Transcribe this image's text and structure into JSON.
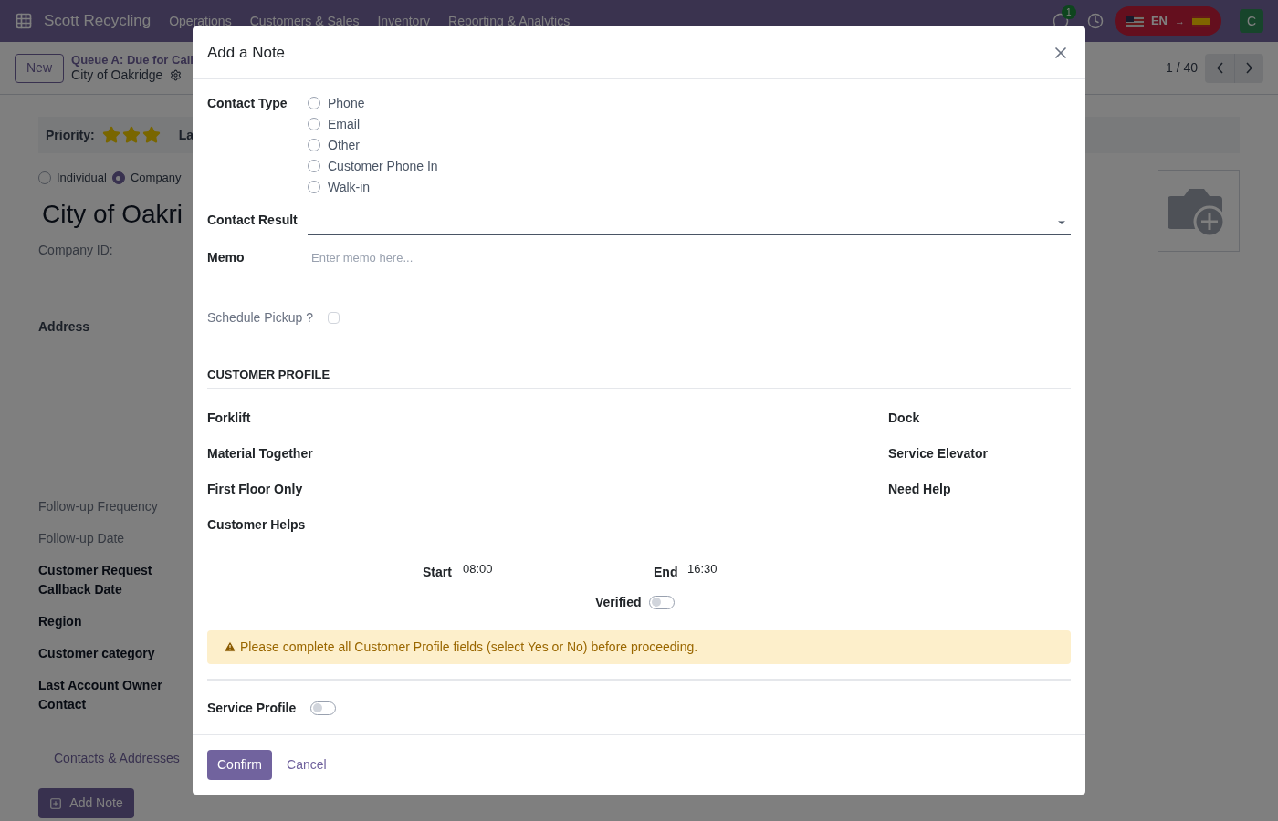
{
  "navbar": {
    "app_name": "Scott Recycling",
    "menus": [
      "Operations",
      "Customers & Sales",
      "Inventory",
      "Reporting & Analytics"
    ],
    "chat_badge": "1",
    "language": "EN",
    "language_on": true,
    "language_arrow": "→",
    "avatar": "C"
  },
  "control_panel": {
    "new_button": "New",
    "breadcrumb": "Queue A: Due for Call",
    "record": "City of Oakridge",
    "pager": "1 / 40"
  },
  "record": {
    "priority_label": "Priority:",
    "stars": 3,
    "next_label": "La",
    "company_types": [
      {
        "label": "Individual",
        "selected": false
      },
      {
        "label": "Company",
        "selected": true
      }
    ],
    "name": "City of Oakri",
    "company_id_label": "Company ID:",
    "address_label": "Address",
    "fields": [
      {
        "label": "Follow-up Frequency",
        "kind": "muted"
      },
      {
        "label": "Follow-up Date",
        "kind": "muted"
      },
      {
        "label": "Customer Request Callback Date",
        "kind": "bold"
      },
      {
        "label": "Region",
        "kind": "bold"
      },
      {
        "label": "Customer category",
        "kind": "bold"
      },
      {
        "label": "Last Account Owner Contact",
        "kind": "bold"
      }
    ],
    "tab": "Contacts & Addresses",
    "add_note_button": "Add Note"
  },
  "dialog": {
    "title": "Add a Note",
    "contact_type_label": "Contact Type",
    "contact_types": [
      {
        "label": "Phone",
        "selected": false
      },
      {
        "label": "Email",
        "selected": false
      },
      {
        "label": "Other",
        "selected": false
      },
      {
        "label": "Customer Phone In",
        "selected": false
      },
      {
        "label": "Walk-in",
        "selected": false
      }
    ],
    "contact_result_label": "Contact Result",
    "memo_label": "Memo",
    "memo": {
      "placeholder": "Enter memo here..."
    },
    "schedule_pickup": {
      "label": "Schedule Pickup ?",
      "checked": false
    },
    "section_title": "CUSTOMER PROFILE",
    "profile_left": [
      "Forklift",
      "Material Together",
      "First Floor Only",
      "Customer Helps"
    ],
    "profile_right": [
      "Dock",
      "Service Elevator",
      "Need Help"
    ],
    "start_label": "Start",
    "start_value": "08:00",
    "end_label": "End",
    "end_value": "16:30",
    "verified": {
      "label": "Verified",
      "on": false
    },
    "warning": "Please complete all Customer Profile fields (select Yes or No) before proceeding.",
    "service_profile": {
      "label": "Service Profile",
      "on": false
    },
    "buttons": {
      "confirm": "Confirm",
      "cancel": "Cancel"
    }
  }
}
